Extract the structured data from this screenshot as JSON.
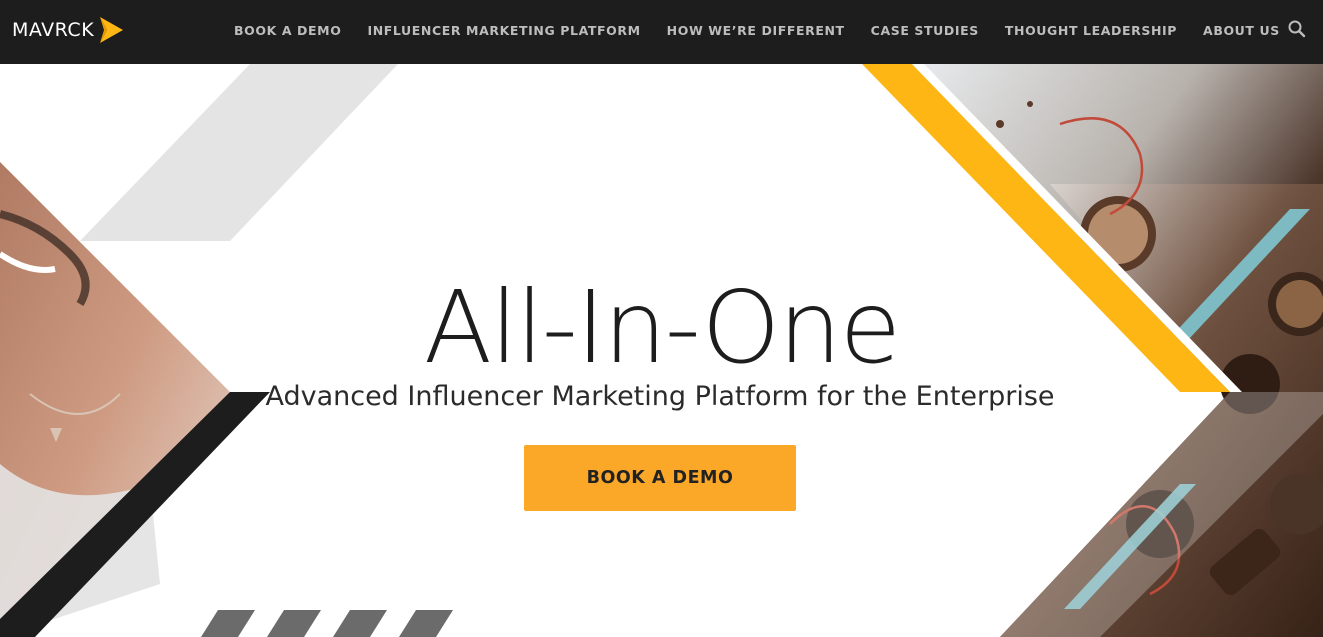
{
  "header": {
    "logo_text": "MAVRCK",
    "nav": [
      "BOOK A DEMO",
      "INFLUENCER MARKETING PLATFORM",
      "HOW WE’RE DIFFERENT",
      "CASE STUDIES",
      "THOUGHT LEADERSHIP",
      "ABOUT US"
    ],
    "search_icon": "search-icon"
  },
  "hero": {
    "title": "All-In-One",
    "subtitle": "Advanced Influencer Marketing Platform for the Enterprise",
    "cta_label": "BOOK A DEMO"
  },
  "colors": {
    "header_bg": "#1d1d1d",
    "accent_orange": "#fba829",
    "stripe_yellow": "#fdb614",
    "dark": "#1d1d1d",
    "light_gray": "#e4e4e4",
    "teal": "#7fc5cf"
  }
}
